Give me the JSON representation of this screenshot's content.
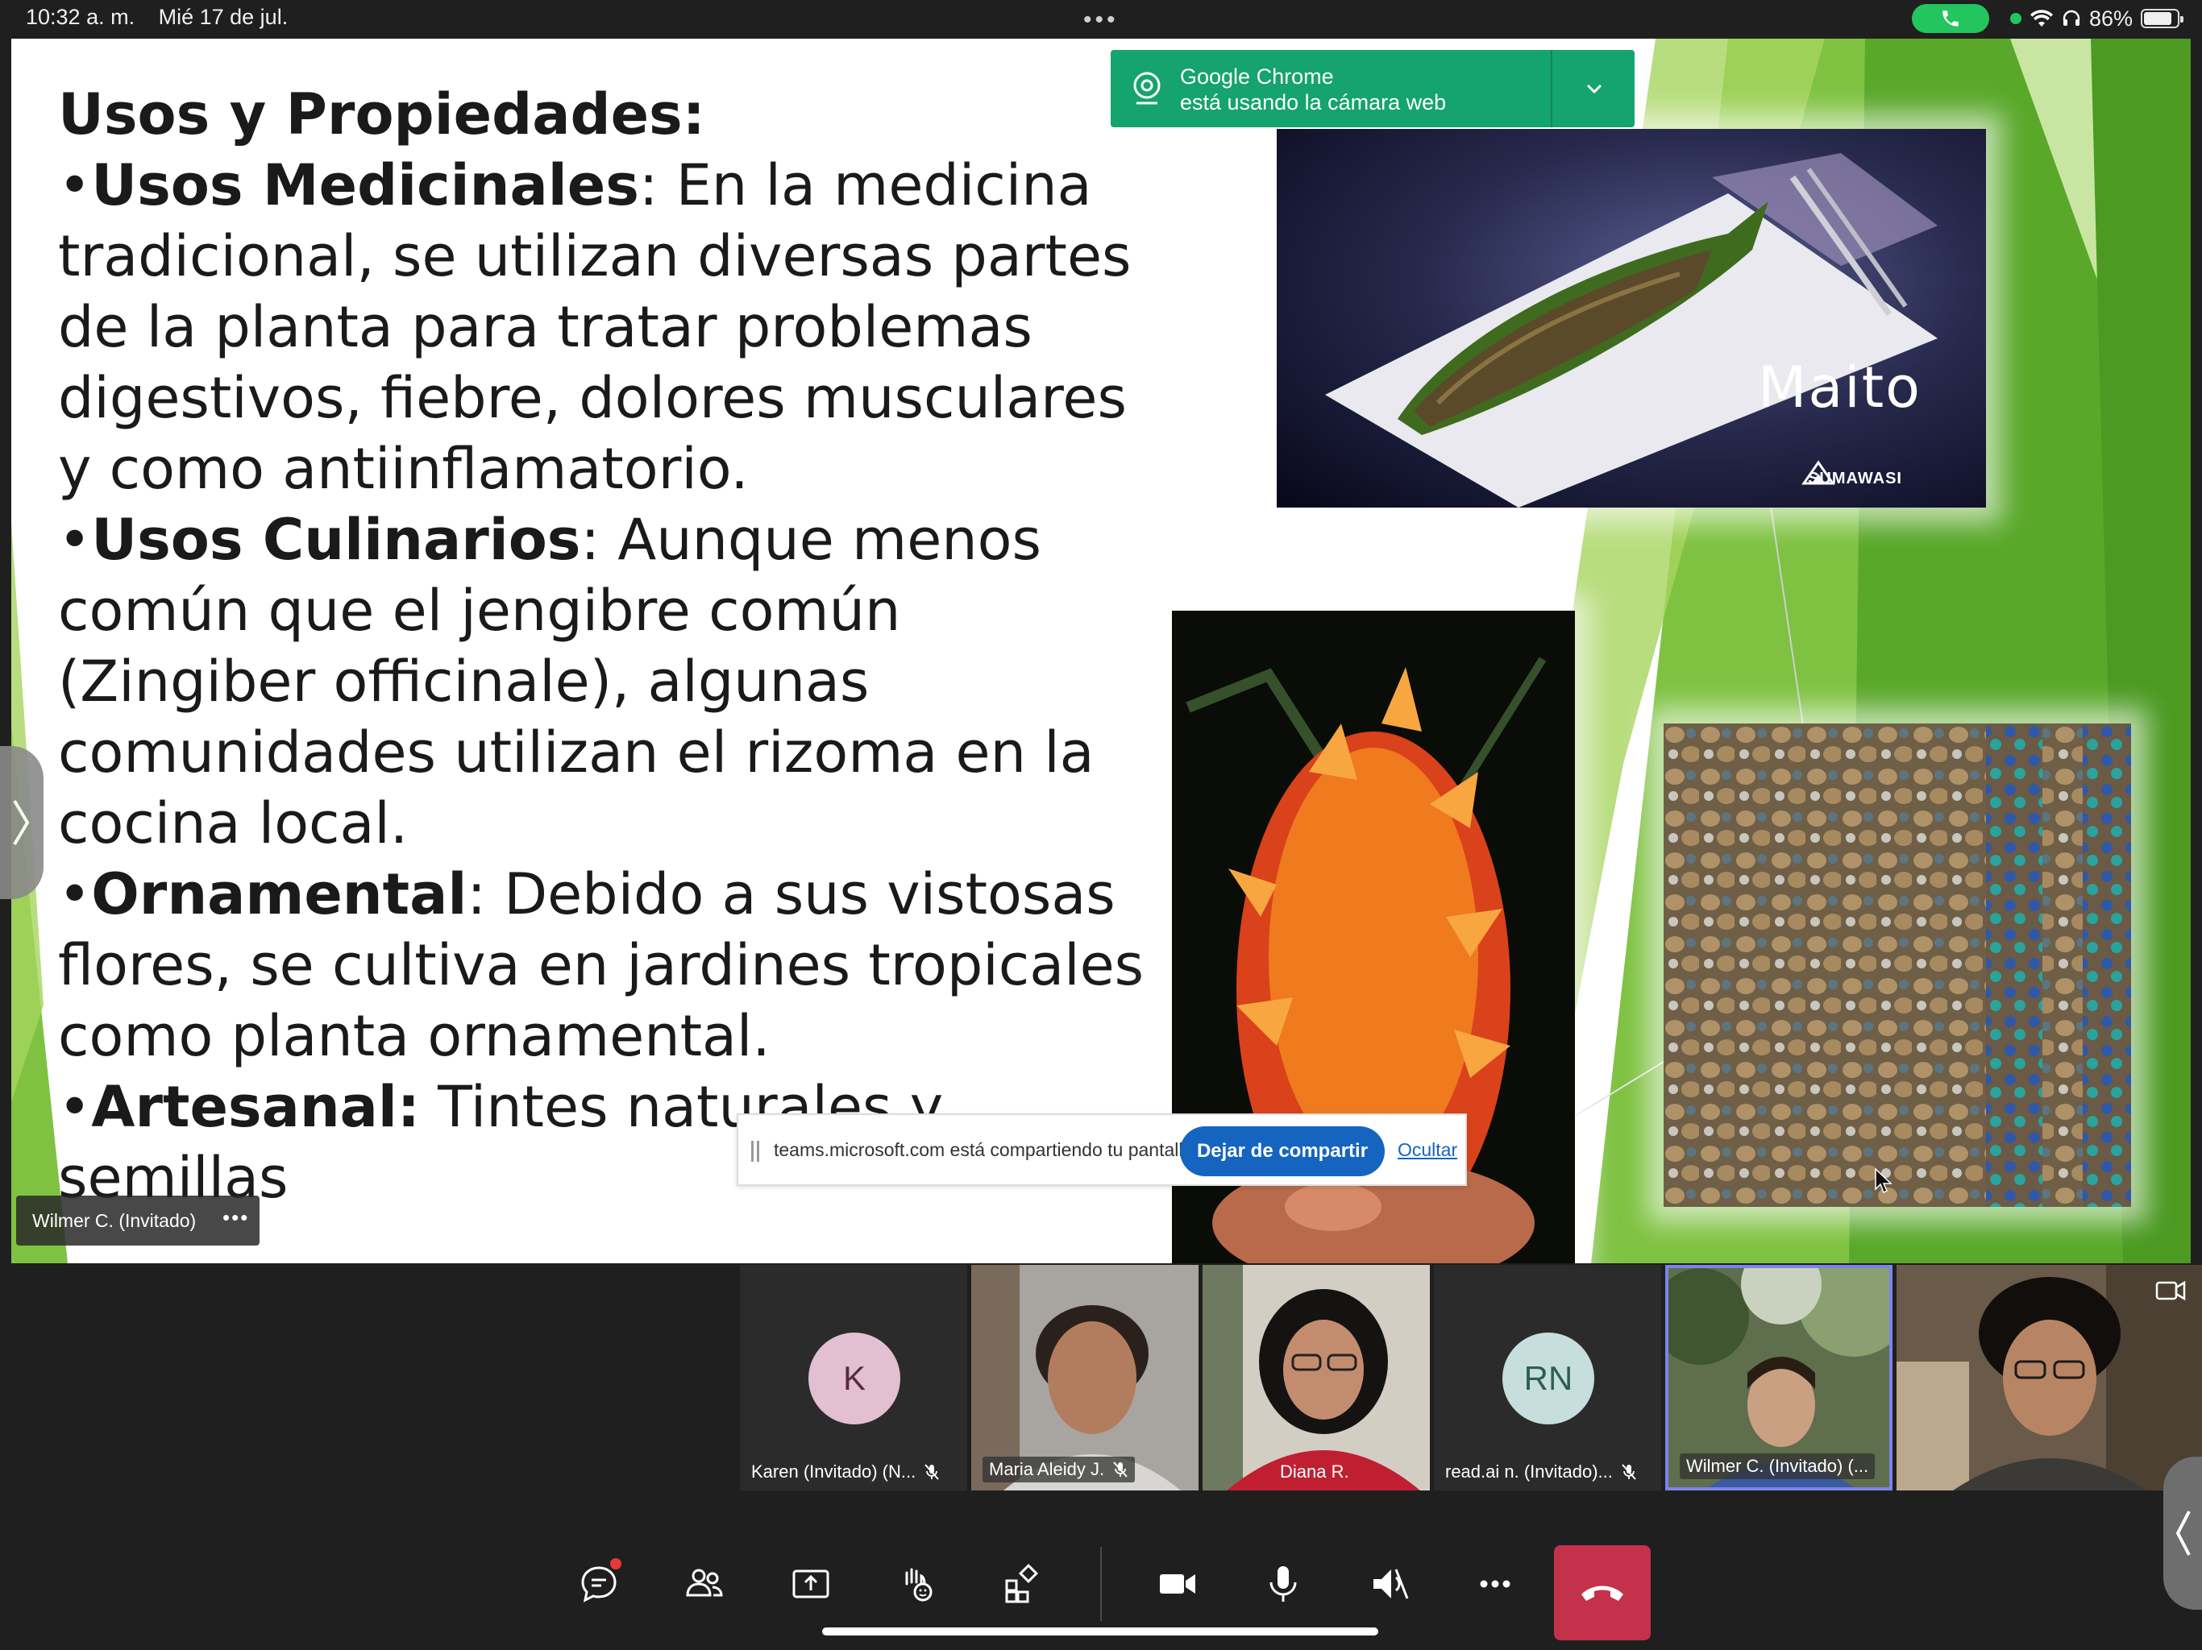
{
  "statusbar": {
    "time": "10:32 a. m.",
    "date": "Mié 17 de jul.",
    "battery": "86%",
    "battery_level": 0.86
  },
  "slide": {
    "title": "Usos y Propiedades:",
    "items": [
      {
        "term": "Usos Medicinales",
        "sep": ":",
        "text": " En la medicina tradicional, se utilizan diversas partes de la planta para tratar problemas digestivos, fiebre, dolores musculares y como antiinflamatorio."
      },
      {
        "term": "Usos Culinarios",
        "sep": ":",
        "text": " Aunque menos común que el jengibre común (Zingiber officinale), algunas comunidades utilizan el rizoma en la cocina local."
      },
      {
        "term": "Ornamental",
        "sep": ":",
        "text": " Debido a sus vistosas flores, se cultiva en jardines tropicales como planta ornamental."
      },
      {
        "term": "Artesanal:",
        "sep": "",
        "text": " Tintes naturales y semillas"
      }
    ],
    "photo_caption": "Maito",
    "logo_text": "SUMAWASI"
  },
  "chrome_notification": {
    "line1": "Google Chrome",
    "line2": "está usando la cámara web"
  },
  "share_bar": {
    "message": "teams.microsoft.com está compartiendo tu pantalla.",
    "stop_label": "Dejar de compartir",
    "hide_label": "Ocultar"
  },
  "presenter": {
    "name": "Wilmer C. (Invitado)",
    "more": "•••"
  },
  "participants": [
    {
      "name": "Karen (Invitado) (N...",
      "initials": "K",
      "avatar_bg": "#e2bfd1",
      "avatar_fg": "#5a2a45",
      "muted": true
    },
    {
      "name": "Maria Aleidy J.",
      "initials": "",
      "muted": true
    },
    {
      "name": "Diana R.",
      "initials": "",
      "muted": false
    },
    {
      "name": "read.ai n. (Invitado)...",
      "initials": "RN",
      "avatar_bg": "#c7dfdc",
      "avatar_fg": "#2e5e5a",
      "muted": true
    },
    {
      "name": "Wilmer C. (Invitado) (...",
      "initials": "",
      "muted": false
    },
    {
      "name": "",
      "initials": "",
      "muted": false
    }
  ],
  "colors": {
    "accent": "#1565c0",
    "teams_active": "#7b83eb",
    "hangup": "#c4314b",
    "notification": "#15a36f"
  }
}
